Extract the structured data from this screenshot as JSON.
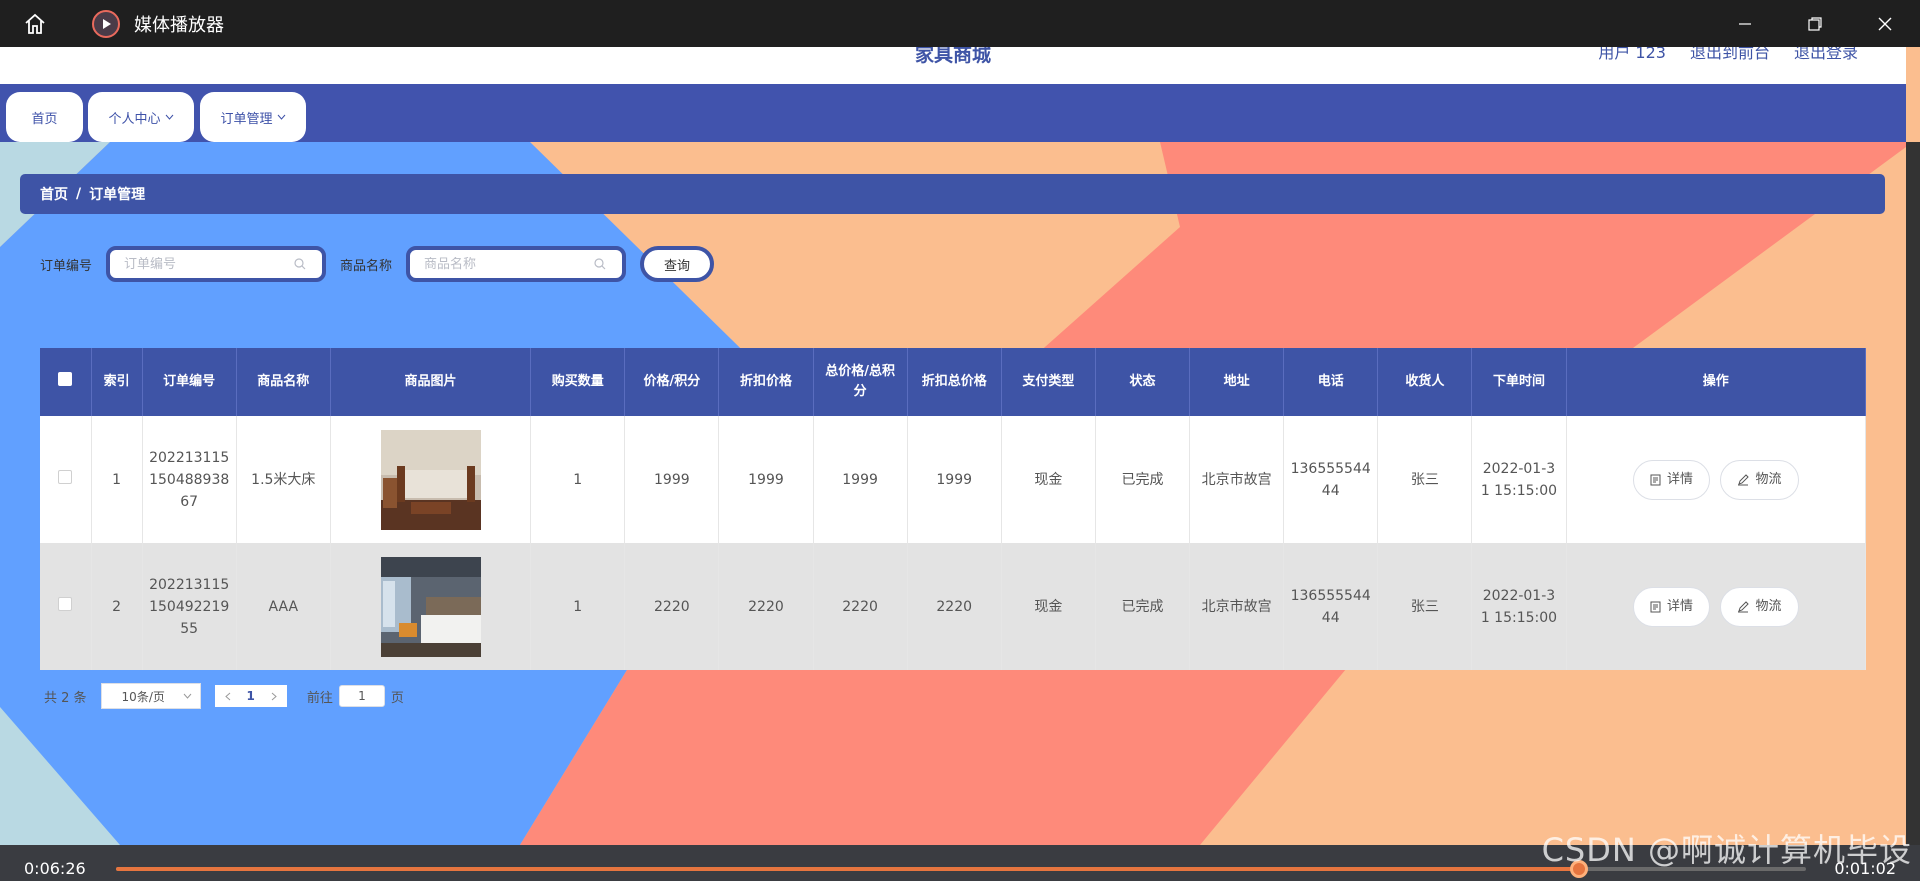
{
  "player": {
    "title": "媒体播放器",
    "time_elapsed": "0:06:26",
    "time_remaining": "0:01:02",
    "progress": 0.8655,
    "accent": "#e6753f"
  },
  "header": {
    "site_title": "家具商城",
    "user": "用户 123",
    "to_frontend": "退出到前台",
    "logout": "退出登录"
  },
  "nav": {
    "home": "首页",
    "personal": "个人中心",
    "orders": "订单管理"
  },
  "breadcrumb": {
    "home": "首页",
    "separator": "/",
    "current": "订单管理"
  },
  "search": {
    "order_label": "订单编号",
    "order_placeholder": "订单编号",
    "product_label": "商品名称",
    "product_placeholder": "商品名称",
    "query_button": "查询"
  },
  "table": {
    "headers": {
      "index": "索引",
      "order_no": "订单编号",
      "product": "商品名称",
      "image": "商品图片",
      "qty": "购买数量",
      "price": "价格/积分",
      "discount_price": "折扣价格",
      "total": "总价格/总积分",
      "discount_total": "折扣总价格",
      "pay_type": "支付类型",
      "status": "状态",
      "address": "地址",
      "phone": "电话",
      "receiver": "收货人",
      "time": "下单时间",
      "ops": "操作"
    },
    "rows": [
      {
        "index": "1",
        "order_no": "202213115150488​93867",
        "product": "1.5米大床",
        "qty": "1",
        "price": "1999",
        "discount_price": "1999",
        "total": "1999",
        "discount_total": "1999",
        "pay_type": "现金",
        "status": "已完成",
        "address": "北京市故宫",
        "phone": "13655554444",
        "receiver": "张三",
        "time": "2022-01-31 15:15:00"
      },
      {
        "index": "2",
        "order_no": "202213115150492​21955",
        "product": "AAA",
        "qty": "1",
        "price": "2220",
        "discount_price": "2220",
        "total": "2220",
        "discount_total": "2220",
        "pay_type": "现金",
        "status": "已完成",
        "address": "北京市故宫",
        "phone": "13655554444",
        "receiver": "张三",
        "time": "2022-01-31 15:15:00"
      }
    ],
    "detail_button": "详情",
    "logistics_button": "物流"
  },
  "pager": {
    "total": "共 2 条",
    "page_size": "10条/页",
    "current_page": "1",
    "goto_label": "前往",
    "goto_value": "1",
    "page_suffix": "页"
  },
  "watermark": "CSDN @啊诚计算机毕设",
  "colors": {
    "primary": "#3e54a6",
    "nav_bg": "#4153ad"
  }
}
